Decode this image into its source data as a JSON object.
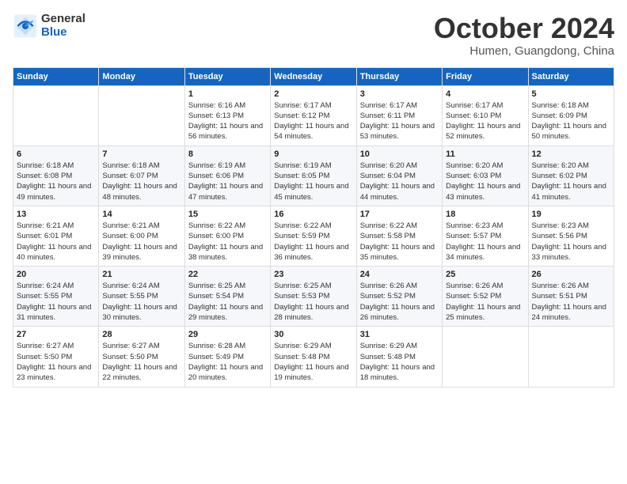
{
  "header": {
    "logo_general": "General",
    "logo_blue": "Blue",
    "month_title": "October 2024",
    "subtitle": "Humen, Guangdong, China"
  },
  "weekdays": [
    "Sunday",
    "Monday",
    "Tuesday",
    "Wednesday",
    "Thursday",
    "Friday",
    "Saturday"
  ],
  "weeks": [
    [
      {
        "day": "",
        "info": ""
      },
      {
        "day": "",
        "info": ""
      },
      {
        "day": "1",
        "info": "Sunrise: 6:16 AM\nSunset: 6:13 PM\nDaylight: 11 hours and 56 minutes."
      },
      {
        "day": "2",
        "info": "Sunrise: 6:17 AM\nSunset: 6:12 PM\nDaylight: 11 hours and 54 minutes."
      },
      {
        "day": "3",
        "info": "Sunrise: 6:17 AM\nSunset: 6:11 PM\nDaylight: 11 hours and 53 minutes."
      },
      {
        "day": "4",
        "info": "Sunrise: 6:17 AM\nSunset: 6:10 PM\nDaylight: 11 hours and 52 minutes."
      },
      {
        "day": "5",
        "info": "Sunrise: 6:18 AM\nSunset: 6:09 PM\nDaylight: 11 hours and 50 minutes."
      }
    ],
    [
      {
        "day": "6",
        "info": "Sunrise: 6:18 AM\nSunset: 6:08 PM\nDaylight: 11 hours and 49 minutes."
      },
      {
        "day": "7",
        "info": "Sunrise: 6:18 AM\nSunset: 6:07 PM\nDaylight: 11 hours and 48 minutes."
      },
      {
        "day": "8",
        "info": "Sunrise: 6:19 AM\nSunset: 6:06 PM\nDaylight: 11 hours and 47 minutes."
      },
      {
        "day": "9",
        "info": "Sunrise: 6:19 AM\nSunset: 6:05 PM\nDaylight: 11 hours and 45 minutes."
      },
      {
        "day": "10",
        "info": "Sunrise: 6:20 AM\nSunset: 6:04 PM\nDaylight: 11 hours and 44 minutes."
      },
      {
        "day": "11",
        "info": "Sunrise: 6:20 AM\nSunset: 6:03 PM\nDaylight: 11 hours and 43 minutes."
      },
      {
        "day": "12",
        "info": "Sunrise: 6:20 AM\nSunset: 6:02 PM\nDaylight: 11 hours and 41 minutes."
      }
    ],
    [
      {
        "day": "13",
        "info": "Sunrise: 6:21 AM\nSunset: 6:01 PM\nDaylight: 11 hours and 40 minutes."
      },
      {
        "day": "14",
        "info": "Sunrise: 6:21 AM\nSunset: 6:00 PM\nDaylight: 11 hours and 39 minutes."
      },
      {
        "day": "15",
        "info": "Sunrise: 6:22 AM\nSunset: 6:00 PM\nDaylight: 11 hours and 38 minutes."
      },
      {
        "day": "16",
        "info": "Sunrise: 6:22 AM\nSunset: 5:59 PM\nDaylight: 11 hours and 36 minutes."
      },
      {
        "day": "17",
        "info": "Sunrise: 6:22 AM\nSunset: 5:58 PM\nDaylight: 11 hours and 35 minutes."
      },
      {
        "day": "18",
        "info": "Sunrise: 6:23 AM\nSunset: 5:57 PM\nDaylight: 11 hours and 34 minutes."
      },
      {
        "day": "19",
        "info": "Sunrise: 6:23 AM\nSunset: 5:56 PM\nDaylight: 11 hours and 33 minutes."
      }
    ],
    [
      {
        "day": "20",
        "info": "Sunrise: 6:24 AM\nSunset: 5:55 PM\nDaylight: 11 hours and 31 minutes."
      },
      {
        "day": "21",
        "info": "Sunrise: 6:24 AM\nSunset: 5:55 PM\nDaylight: 11 hours and 30 minutes."
      },
      {
        "day": "22",
        "info": "Sunrise: 6:25 AM\nSunset: 5:54 PM\nDaylight: 11 hours and 29 minutes."
      },
      {
        "day": "23",
        "info": "Sunrise: 6:25 AM\nSunset: 5:53 PM\nDaylight: 11 hours and 28 minutes."
      },
      {
        "day": "24",
        "info": "Sunrise: 6:26 AM\nSunset: 5:52 PM\nDaylight: 11 hours and 26 minutes."
      },
      {
        "day": "25",
        "info": "Sunrise: 6:26 AM\nSunset: 5:52 PM\nDaylight: 11 hours and 25 minutes."
      },
      {
        "day": "26",
        "info": "Sunrise: 6:26 AM\nSunset: 5:51 PM\nDaylight: 11 hours and 24 minutes."
      }
    ],
    [
      {
        "day": "27",
        "info": "Sunrise: 6:27 AM\nSunset: 5:50 PM\nDaylight: 11 hours and 23 minutes."
      },
      {
        "day": "28",
        "info": "Sunrise: 6:27 AM\nSunset: 5:50 PM\nDaylight: 11 hours and 22 minutes."
      },
      {
        "day": "29",
        "info": "Sunrise: 6:28 AM\nSunset: 5:49 PM\nDaylight: 11 hours and 20 minutes."
      },
      {
        "day": "30",
        "info": "Sunrise: 6:29 AM\nSunset: 5:48 PM\nDaylight: 11 hours and 19 minutes."
      },
      {
        "day": "31",
        "info": "Sunrise: 6:29 AM\nSunset: 5:48 PM\nDaylight: 11 hours and 18 minutes."
      },
      {
        "day": "",
        "info": ""
      },
      {
        "day": "",
        "info": ""
      }
    ]
  ]
}
